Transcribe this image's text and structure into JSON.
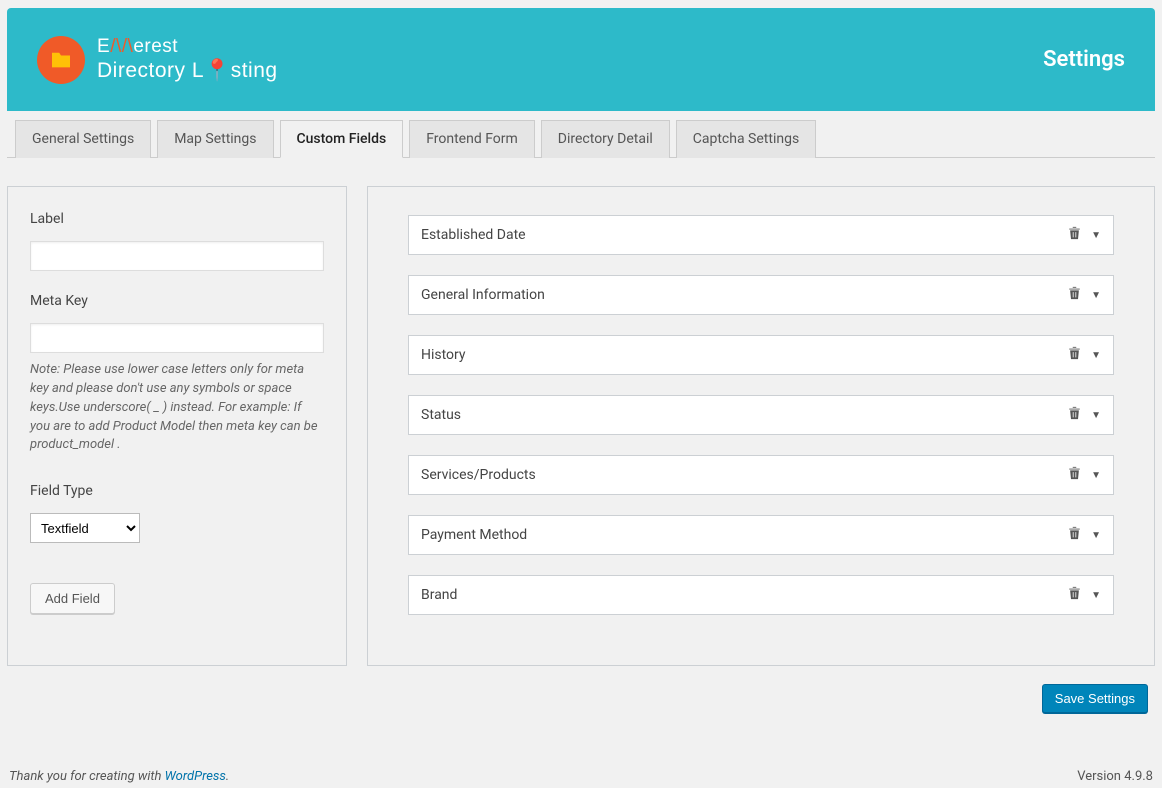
{
  "banner": {
    "logo_line1_pre": "E",
    "logo_line1_accent": "M",
    "logo_line1_post": "erest",
    "logo_line2_pre": "Directory L",
    "logo_line2_post": "sting",
    "page_title": "Settings"
  },
  "tabs": [
    {
      "label": "General Settings",
      "active": false
    },
    {
      "label": "Map Settings",
      "active": false
    },
    {
      "label": "Custom Fields",
      "active": true
    },
    {
      "label": "Frontend Form",
      "active": false
    },
    {
      "label": "Directory Detail",
      "active": false
    },
    {
      "label": "Captcha Settings",
      "active": false
    }
  ],
  "form": {
    "label_label": "Label",
    "label_value": "",
    "metakey_label": "Meta Key",
    "metakey_value": "",
    "metakey_note": "Note: Please use lower case letters only for meta key and please don't use any symbols or space keys.Use underscore( _ ) instead. For example: If you are to add Product Model then meta key can be product_model .",
    "fieldtype_label": "Field Type",
    "fieldtype_value": "Textfield",
    "add_button": "Add Field"
  },
  "custom_fields": [
    {
      "name": "Established Date"
    },
    {
      "name": "General Information"
    },
    {
      "name": "History"
    },
    {
      "name": "Status"
    },
    {
      "name": "Services/Products"
    },
    {
      "name": "Payment Method"
    },
    {
      "name": "Brand"
    }
  ],
  "save_button": "Save Settings",
  "footer": {
    "left_pre": "Thank you for creating with ",
    "left_link": "WordPress",
    "left_post": ".",
    "version_label": "Version ",
    "version": "4.9.8"
  }
}
